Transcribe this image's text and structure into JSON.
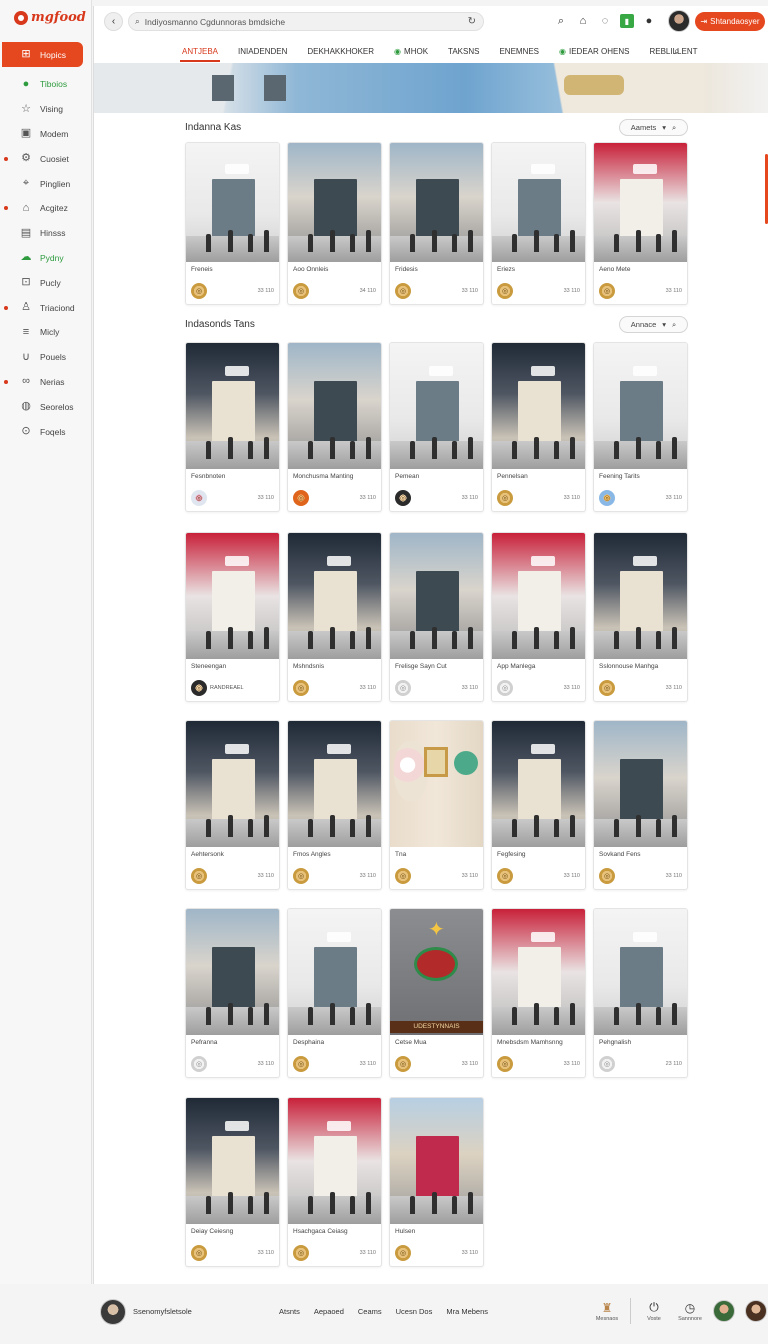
{
  "brand": {
    "name": "mgfood",
    "color": "#d8391c"
  },
  "sidebar": {
    "active": {
      "label": "Hopics",
      "icon": "gift-icon"
    },
    "items": [
      {
        "label": "Tiboios",
        "icon": "leaf-icon",
        "green": true,
        "dot": false
      },
      {
        "label": "Vising",
        "icon": "star-icon",
        "green": false,
        "dot": false
      },
      {
        "label": "Modem",
        "icon": "screen-icon",
        "green": false,
        "dot": false
      },
      {
        "label": "Cuosiet",
        "icon": "gear-icon",
        "green": false,
        "dot": true
      },
      {
        "label": "Pinglien",
        "icon": "pin-icon",
        "green": false,
        "dot": false
      },
      {
        "label": "Acgitez",
        "icon": "bag-icon",
        "green": false,
        "dot": true
      },
      {
        "label": "Hinsss",
        "icon": "grid-icon",
        "green": false,
        "dot": false
      },
      {
        "label": "Pydny",
        "icon": "cloud-icon",
        "green": true,
        "dot": false
      },
      {
        "label": "Pucly",
        "icon": "cart-icon",
        "green": false,
        "dot": false
      },
      {
        "label": "Triaciond",
        "icon": "user-icon",
        "green": false,
        "dot": true
      },
      {
        "label": "Micly",
        "icon": "list-icon",
        "green": false,
        "dot": false
      },
      {
        "label": "Pouels",
        "icon": "magnet-icon",
        "green": false,
        "dot": false
      },
      {
        "label": "Nerias",
        "icon": "link-icon",
        "green": false,
        "dot": true
      },
      {
        "label": "Seorelos",
        "icon": "globe-icon",
        "green": false,
        "dot": false
      },
      {
        "label": "Foqels",
        "icon": "dollar-icon",
        "green": false,
        "dot": false
      }
    ]
  },
  "topbar": {
    "url": "Indiyosmanno Cgdunnoras bmdsiche",
    "cta_label": "Shtandaosyer"
  },
  "tabs": [
    {
      "label": "ANTJEBA",
      "active": true,
      "green": false
    },
    {
      "label": "INIADENDEN",
      "active": false,
      "green": false
    },
    {
      "label": "DEKHAKKHOKER",
      "active": false,
      "green": false
    },
    {
      "label": "MHOK",
      "active": false,
      "green": true
    },
    {
      "label": "TAKSNS",
      "active": false,
      "green": false
    },
    {
      "label": "ENEMNES",
      "active": false,
      "green": false
    },
    {
      "label": "IEDEAR OHENS",
      "active": false,
      "green": true
    },
    {
      "label": "REBLILLENT",
      "active": false,
      "green": false
    }
  ],
  "sections": [
    {
      "title": "Indanna Kas",
      "filter": "Aamets"
    },
    {
      "title": "Indasonds Tans",
      "filter": "Annace"
    }
  ],
  "cards_row1": [
    {
      "name": "Freneis",
      "count": "33 110",
      "palette": "white"
    },
    {
      "name": "Aoo Onnleis",
      "count": "34 110",
      "palette": "mall"
    },
    {
      "name": "Fridesis",
      "count": "33 110",
      "palette": "mall"
    },
    {
      "name": "Eriezs",
      "count": "33 110",
      "palette": "white"
    },
    {
      "name": "Aeno Mete",
      "count": "33 110",
      "palette": "red"
    }
  ],
  "cards_rows": [
    [
      {
        "name": "Fesnbnoten",
        "count": "33 110",
        "palette": "dark",
        "badge": "pink"
      },
      {
        "name": "Monchusma Manting",
        "count": "33 110",
        "palette": "mall",
        "badge": "orange"
      },
      {
        "name": "Pemean",
        "count": "33 110",
        "palette": "white",
        "badge": "dark"
      },
      {
        "name": "Pennelsan",
        "count": "33 110",
        "palette": "dark",
        "badge": "gold"
      },
      {
        "name": "Feening Tarits",
        "count": "33 110",
        "palette": "white",
        "badge": "blue"
      }
    ],
    [
      {
        "name": "Steneengan",
        "count": "",
        "palette": "red",
        "badge": "dark",
        "badge_text": "RANDREAEL"
      },
      {
        "name": "Mshndsnis",
        "count": "33 110",
        "palette": "dark",
        "badge": "gold"
      },
      {
        "name": "Frelisge Sayn Cut",
        "count": "33 110",
        "palette": "mall",
        "badge": "gray"
      },
      {
        "name": "App Manlega",
        "count": "33 110",
        "palette": "red",
        "badge": "gray"
      },
      {
        "name": "Sslonnouse Manhga",
        "count": "33 110",
        "palette": "dark",
        "badge": "gold"
      }
    ],
    [
      {
        "name": "Aehtersonk",
        "count": "33 110",
        "palette": "dark",
        "badge": "gold"
      },
      {
        "name": "Fmos Angles",
        "count": "33 110",
        "palette": "dark",
        "badge": "gold"
      },
      {
        "name": "Tna",
        "count": "33 110",
        "palette": "flower",
        "badge": "gold"
      },
      {
        "name": "Fegfesing",
        "count": "33 110",
        "palette": "dark",
        "badge": "gold"
      },
      {
        "name": "Sovkand Fens",
        "count": "33 110",
        "palette": "mall",
        "badge": "gold"
      }
    ],
    [
      {
        "name": "Pefranna",
        "count": "33 110",
        "palette": "mall",
        "badge": "gray"
      },
      {
        "name": "Desphaina",
        "count": "33 110",
        "palette": "white",
        "badge": "gold"
      },
      {
        "name": "Cetse Mua",
        "count": "33 110",
        "palette": "emblem",
        "badge": "gold",
        "emblem_text": "UDESTYNNAIS"
      },
      {
        "name": "Mnebsdsm Mamhsnng",
        "count": "33 110",
        "palette": "red",
        "badge": "gold"
      },
      {
        "name": "Pehgnalish",
        "count": "23 110",
        "palette": "white",
        "badge": "gray"
      }
    ],
    [
      {
        "name": "Deiay Ceiesng",
        "count": "33 110",
        "palette": "dark",
        "badge": "gold"
      },
      {
        "name": "Hsachgaca Ceiasg",
        "count": "33 110",
        "palette": "red",
        "badge": "gold"
      },
      {
        "name": "Hulsen",
        "count": "33 110",
        "palette": "palm",
        "badge": "gold"
      }
    ]
  ],
  "footer": {
    "user": "Ssenomyfsletsole",
    "links": [
      "Atsnts",
      "Aepaoed",
      "Ceams",
      "Ucesn Dos",
      "Mra Mebens"
    ],
    "icons": [
      {
        "label": "Mesnaos",
        "icon": "figure-icon"
      },
      {
        "label": "Voste",
        "icon": "power-icon"
      },
      {
        "label": "Sannnore",
        "icon": "clock-icon"
      }
    ]
  }
}
